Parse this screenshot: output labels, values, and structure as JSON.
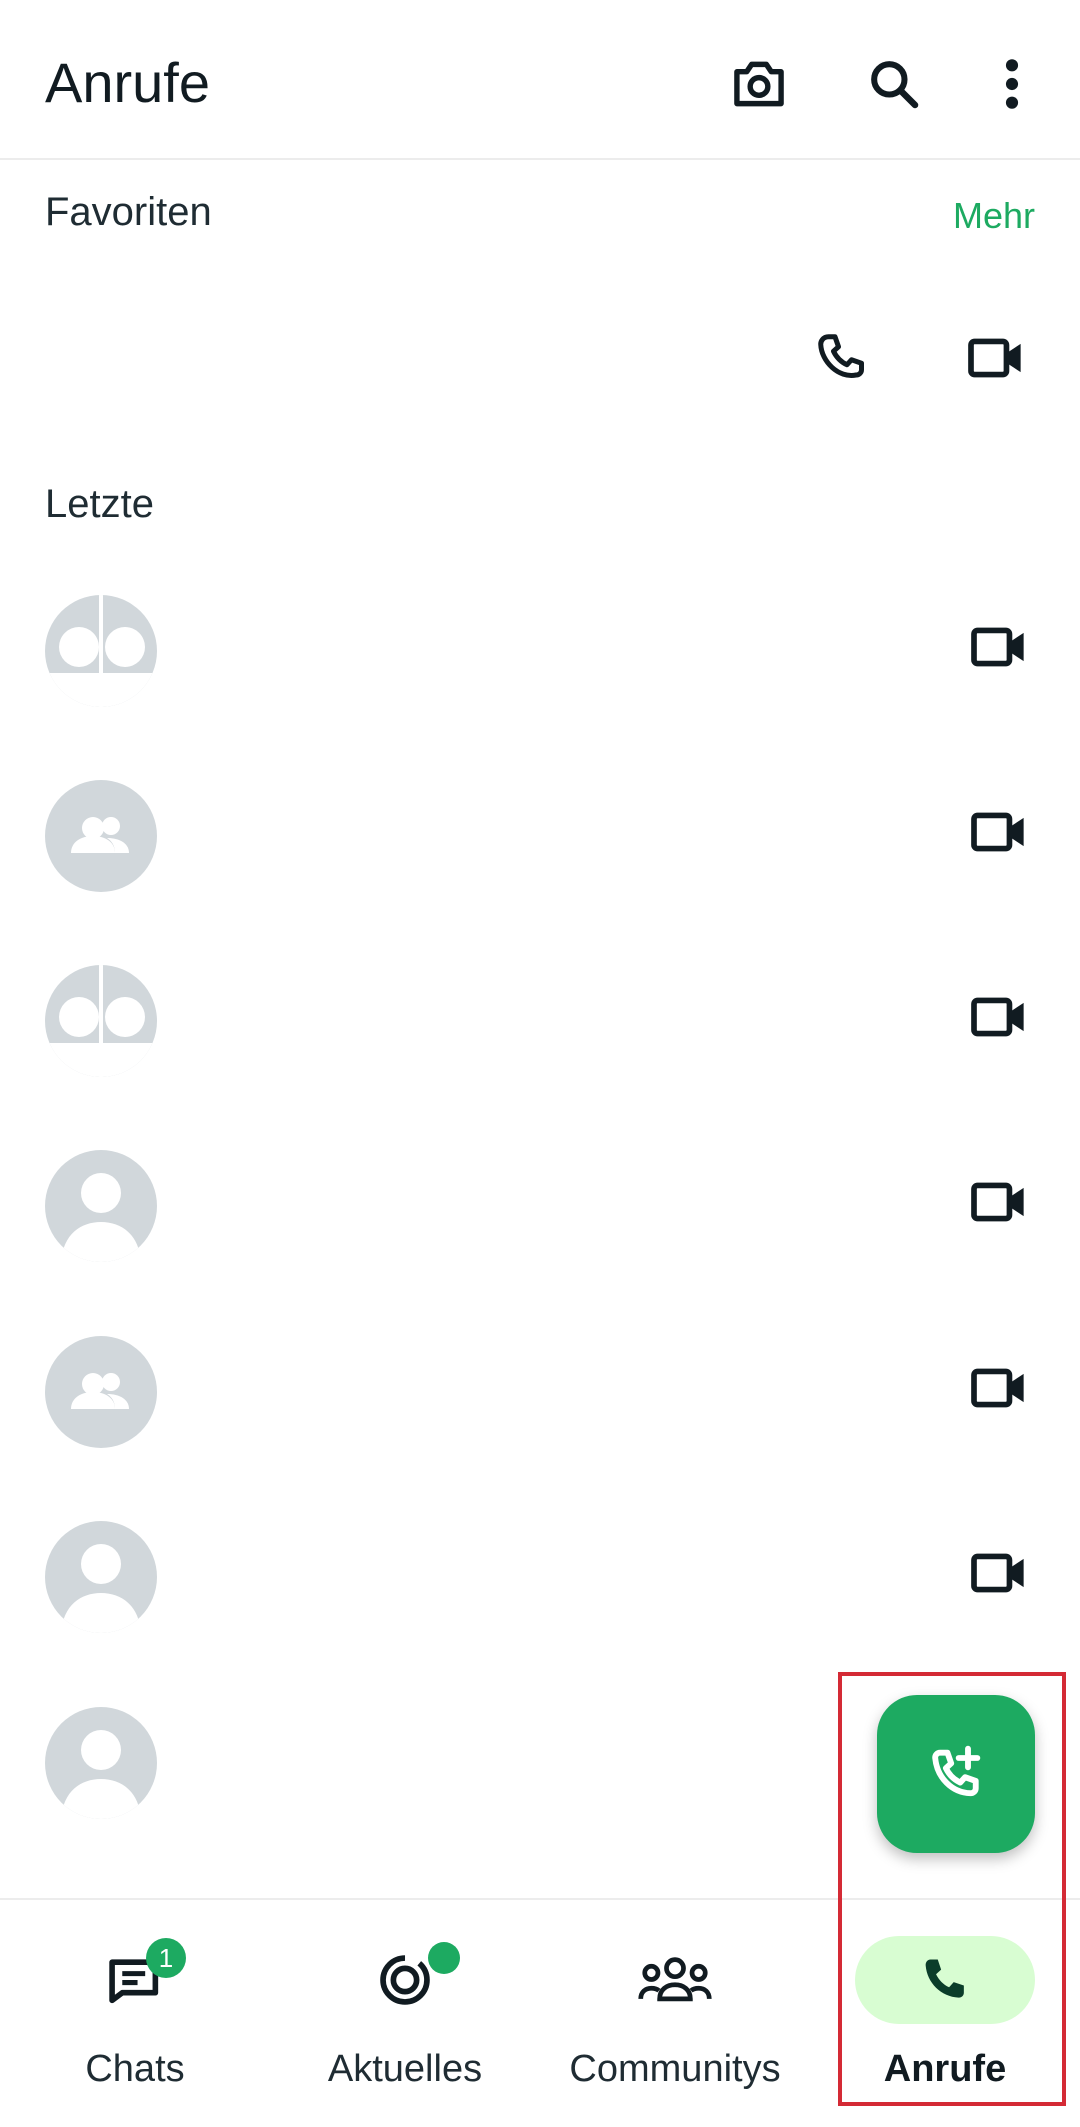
{
  "header": {
    "title": "Anrufe",
    "icons": [
      "camera-icon",
      "search-icon",
      "more-vert-icon"
    ]
  },
  "favorites": {
    "label": "Favoriten",
    "more_label": "Mehr",
    "icons": [
      "phone-icon",
      "video-icon"
    ]
  },
  "recent": {
    "label": "Letzte",
    "rows": [
      {
        "avatar": "broken-image-avatar"
      },
      {
        "avatar": "group-avatar"
      },
      {
        "avatar": "broken-image-avatar"
      },
      {
        "avatar": "person-avatar"
      },
      {
        "avatar": "group-avatar"
      },
      {
        "avatar": "person-avatar"
      },
      {
        "avatar": "person-avatar"
      }
    ]
  },
  "fab": {
    "icon": "add-call-icon"
  },
  "nav": {
    "items": [
      {
        "label": "Chats",
        "badge": "1",
        "icon": "chats-icon"
      },
      {
        "label": "Aktuelles",
        "icon": "updates-icon"
      },
      {
        "label": "Communitys",
        "icon": "communities-icon"
      },
      {
        "label": "Anrufe",
        "icon": "calls-icon",
        "active": true
      }
    ]
  },
  "colors": {
    "accent": "#1daa61",
    "active_pill": "#d8fdd2",
    "avatar_bg": "#d1d7db",
    "highlight": "#d42a35"
  }
}
